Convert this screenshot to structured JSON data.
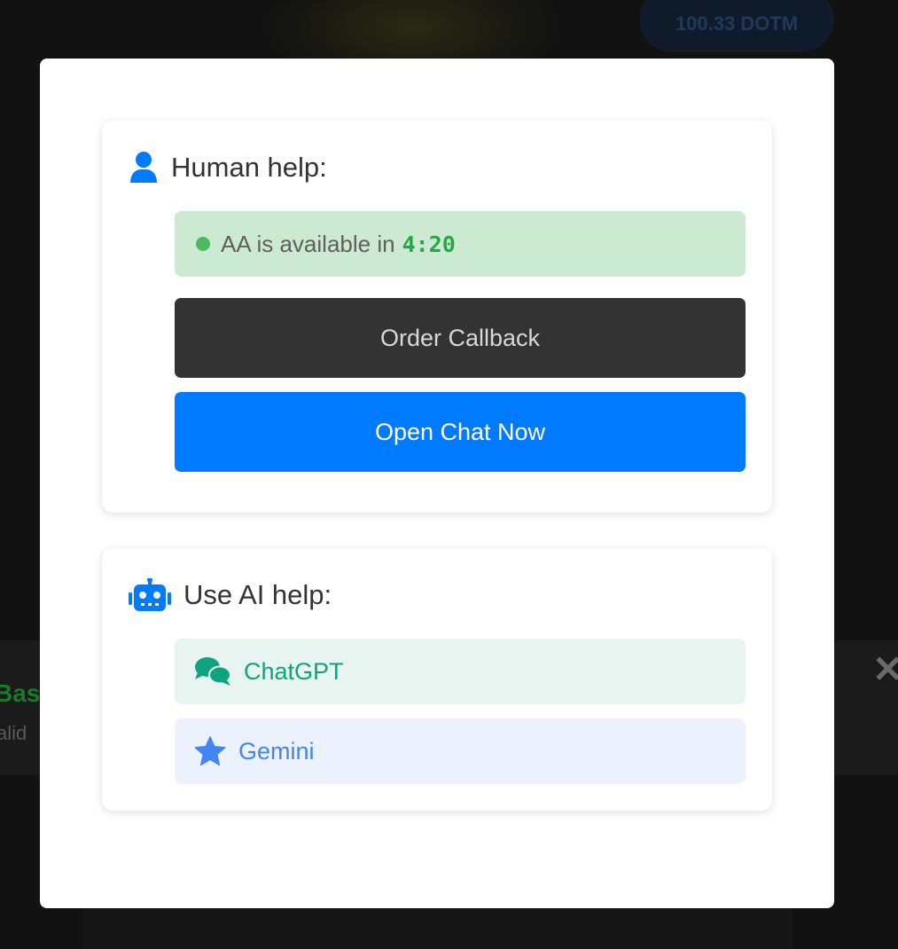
{
  "background": {
    "balance_label": "100.33 DOTM",
    "strip_title": "Basi",
    "strip_subtitle": "alid",
    "close_glyph": "✕"
  },
  "human": {
    "title": "Human help:",
    "icon": "user-icon",
    "status_prefix": "AA is available in",
    "status_time": "4:20",
    "callback_label": "Order Callback",
    "chat_label": "Open Chat Now"
  },
  "ai": {
    "title": "Use AI help:",
    "icon": "robot-icon",
    "options": [
      {
        "label": "ChatGPT",
        "icon": "comments-icon",
        "color": "#10a37f"
      },
      {
        "label": "Gemini",
        "icon": "star-icon",
        "color": "#4285f4"
      }
    ]
  },
  "colors": {
    "primary": "#007bff",
    "dark_button": "#333333",
    "status_bg": "#cce9d2",
    "status_dot": "#4cbb5e",
    "status_time": "#28a745"
  }
}
